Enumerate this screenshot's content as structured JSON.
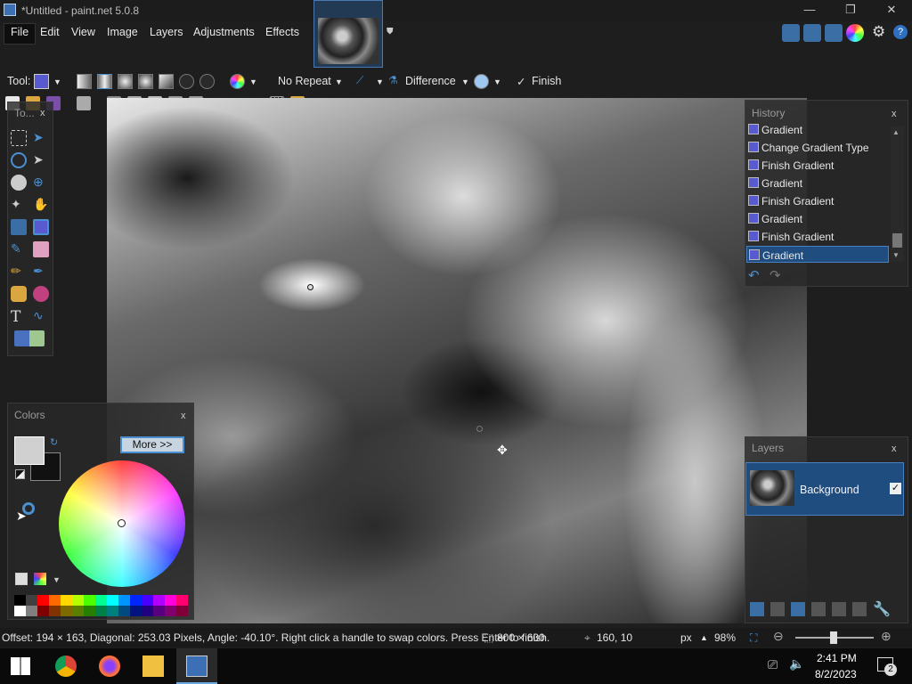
{
  "window": {
    "title": "*Untitled - paint.net 5.0.8",
    "minimize": "—",
    "maximize": "❐",
    "close": "✕"
  },
  "menu": {
    "items": [
      "File",
      "Edit",
      "View",
      "Image",
      "Layers",
      "Adjustments",
      "Effects"
    ]
  },
  "toolbar2": {
    "tool_label": "Tool:",
    "repeat_mode": "No Repeat",
    "blend_mode": "Difference",
    "finish_label": "Finish"
  },
  "tools_panel": {
    "title": "To...",
    "close": "x"
  },
  "colors_panel": {
    "title": "Colors",
    "close": "x",
    "more_button": "More >>",
    "primary_color": "#d0d0d0",
    "secondary_color": "#111111"
  },
  "history_panel": {
    "title": "History",
    "close": "x",
    "items": [
      "Gradient",
      "Change Gradient Type",
      "Finish Gradient",
      "Gradient",
      "Finish Gradient",
      "Gradient",
      "Finish Gradient",
      "Gradient"
    ],
    "selected_index": 7
  },
  "layers_panel": {
    "title": "Layers",
    "close": "x",
    "layer_name": "Background",
    "layer_visible": true
  },
  "status": {
    "message": "Offset: 194 × 163, Diagonal: 253.03 Pixels, Angle: -40.10°. Right click a handle to swap colors. Press Enter to finish.",
    "image_size": "800 × 600",
    "cursor_pos": "160, 10",
    "unit": "px",
    "zoom": "98%"
  },
  "taskbar": {
    "time": "2:41 PM",
    "date": "8/2/2023",
    "notification_count": "2"
  }
}
